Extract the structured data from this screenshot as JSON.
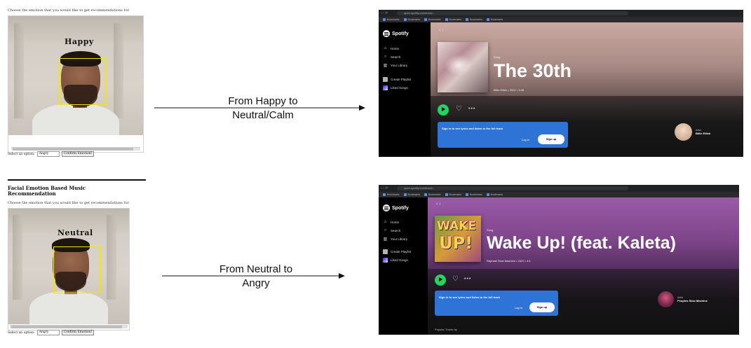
{
  "top_app": {
    "caption": "Choose the emotion that you would like to get recommendations for.",
    "emotion_label": "Happy",
    "select_label": "Select an option:",
    "select_value": "Angry",
    "confirm_button": "Confirm Emotion!"
  },
  "bottom_app": {
    "title": "Facial Emotion Based Music Recommendation",
    "caption": "Choose the emotion that you would like to get recommendations for.",
    "emotion_label": "Neutral",
    "select_label": "Select an option:",
    "select_value": "Angry",
    "confirm_button": "Confirm Emotion!"
  },
  "arrows": [
    {
      "line1": "From Happy to",
      "line2": "Neutral/Calm"
    },
    {
      "line1": "From Neutral to",
      "line2": "Angry"
    }
  ],
  "spotify_top": {
    "url": "open.spotify.com/track/...",
    "nav": [
      "Home",
      "Search",
      "Your Library",
      "Create Playlist",
      "Liked Songs"
    ],
    "nav_icons": [
      "home-icon",
      "search-icon",
      "library-icon",
      "plus-icon",
      "heart-icon"
    ],
    "logo": "Spotify",
    "kind": "Song",
    "title": "The 30th",
    "meta": "Billie Eilish • 2022 • 3:38",
    "banner_text": "Sign in to see lyrics and listen to the full track",
    "login": "Log in",
    "signup": "Sign up",
    "artist_label": "Artist",
    "artist_name": "Billie Eilish",
    "hero_color": "#c7a59e"
  },
  "spotify_bottom": {
    "url": "open.spotify.com/track/...",
    "nav": [
      "Home",
      "Search",
      "Your Library",
      "Create Playlist",
      "Liked Songs"
    ],
    "nav_icons": [
      "home-icon",
      "search-icon",
      "library-icon",
      "plus-icon",
      "heart-icon"
    ],
    "logo": "Spotify",
    "kind": "Song",
    "title": "Wake Up! (feat. Kaleta)",
    "meta": "Raphael Slow Machine • 2022 • 4:4",
    "banner_text": "Sign in to see lyrics and listen to the full track",
    "login": "Log in",
    "signup": "Sign up",
    "artist_label": "Artist",
    "artist_name": "Peoples Slow Machine",
    "popular_label": "Popular Tracks by",
    "cover_text": [
      "WAKE",
      "UP!"
    ],
    "hero_color": "#8a4d98"
  },
  "colors": {
    "spotify_green": "#1ed760",
    "banner_blue": "#2d74d6",
    "face_box": "#f2e600"
  }
}
